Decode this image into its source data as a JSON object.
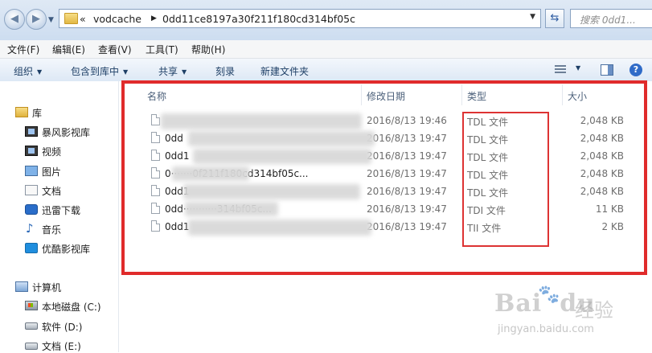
{
  "address_bar": {
    "overflow": "«",
    "crumbs": [
      "vodcache",
      "0dd11ce8197a30f211f180cd314bf05c"
    ],
    "search_placeholder": "搜索 0dd1..."
  },
  "menu": [
    "文件(F)",
    "编辑(E)",
    "查看(V)",
    "工具(T)",
    "帮助(H)"
  ],
  "toolbar": {
    "organize": "组织",
    "include_library": "包含到库中",
    "share": "共享",
    "burn": "刻录",
    "new_folder": "新建文件夹"
  },
  "nav": {
    "library": "库",
    "library_items": [
      "暴风影视库",
      "视频",
      "图片",
      "文档",
      "迅雷下载",
      "音乐",
      "优酷影视库"
    ],
    "computer": "计算机",
    "drives": [
      "本地磁盘 (C:)",
      "软件 (D:)",
      "文档 (E:)"
    ]
  },
  "columns": {
    "name": "名称",
    "date": "修改日期",
    "type": "类型",
    "size": "大小"
  },
  "files": [
    {
      "name": "",
      "date": "2016/8/13 19:46",
      "type": "TDL 文件",
      "size": "2,048 KB"
    },
    {
      "name": "0dd",
      "date": "2016/8/13 19:47",
      "type": "TDL 文件",
      "size": "2,048 KB"
    },
    {
      "name": "0dd1",
      "date": "2016/8/13 19:47",
      "type": "TDL 文件",
      "size": "2,048 KB"
    },
    {
      "name": "0·······0f211f180cd314bf05c...",
      "date": "2016/8/13 19:47",
      "type": "TDL 文件",
      "size": "2,048 KB"
    },
    {
      "name": "0dd1",
      "date": "2016/8/13 19:47",
      "type": "TDL 文件",
      "size": "2,048 KB"
    },
    {
      "name": "0dd···········314bf05c...",
      "date": "2016/8/13 19:47",
      "type": "TDI 文件",
      "size": "11 KB"
    },
    {
      "name": "0dd1",
      "date": "2016/8/13 19:47",
      "type": "TII 文件",
      "size": "2 KB"
    }
  ],
  "watermark": {
    "logo": "Bai",
    "logo_tail": "du",
    "cn": "经验",
    "url": "jingyan.baidu.com"
  }
}
